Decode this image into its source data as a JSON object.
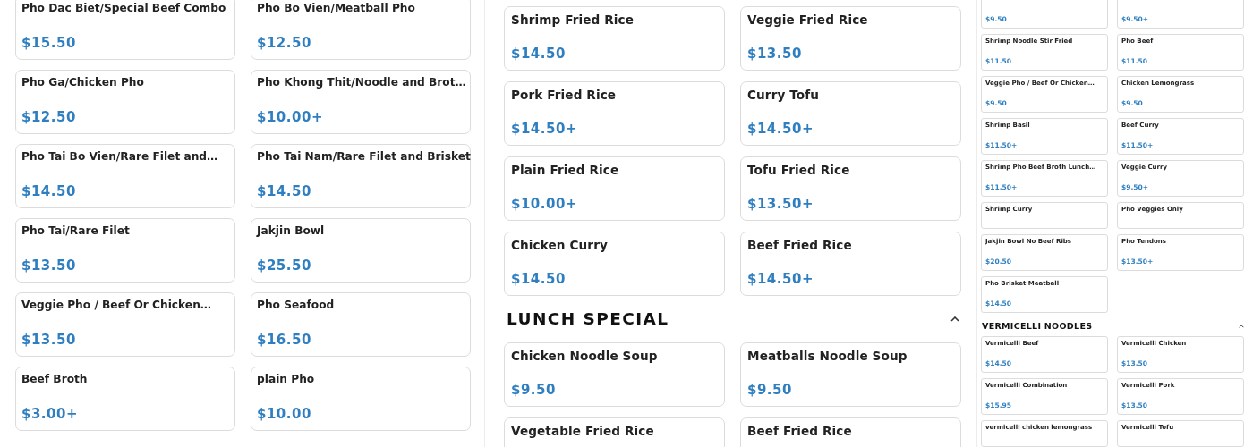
{
  "panes": [
    {
      "kind": "large",
      "sections": [
        {
          "items": [
            {
              "name": "Pho Dac Biet/Special Beef Combo",
              "price": "$15.50"
            },
            {
              "name": "Pho Bo Vien/Meatball Pho",
              "price": "$12.50"
            },
            {
              "name": "Pho Ga/Chicken Pho",
              "price": "$12.50"
            },
            {
              "name": "Pho Khong Thit/Noodle and Brot…",
              "price": "$10.00+"
            },
            {
              "name": "Pho Tai Bo Vien/Rare Filet and…",
              "price": "$14.50"
            },
            {
              "name": "Pho Tai Nam/Rare Filet and Brisket",
              "price": "$14.50"
            },
            {
              "name": "Pho Tai/Rare Filet",
              "price": "$13.50"
            },
            {
              "name": "Jakjin Bowl",
              "price": "$25.50"
            },
            {
              "name": "Veggie Pho / Beef Or Chicken…",
              "price": "$13.50"
            },
            {
              "name": "Pho Seafood",
              "price": "$16.50"
            },
            {
              "name": "Beef Broth",
              "price": "$3.00+"
            },
            {
              "name": "plain Pho",
              "price": "$10.00"
            }
          ]
        }
      ]
    },
    {
      "kind": "medium",
      "sections": [
        {
          "items": [
            {
              "name": "Shrimp Fried Rice",
              "price": "$14.50"
            },
            {
              "name": "Veggie Fried Rice",
              "price": "$13.50"
            },
            {
              "name": "Pork Fried Rice",
              "price": "$14.50+"
            },
            {
              "name": "Curry Tofu",
              "price": "$14.50+"
            },
            {
              "name": "Plain Fried Rice",
              "price": "$10.00+"
            },
            {
              "name": "Tofu Fried Rice",
              "price": "$13.50+"
            },
            {
              "name": "Chicken Curry",
              "price": "$14.50"
            },
            {
              "name": "Beef Fried Rice",
              "price": "$14.50+"
            }
          ]
        },
        {
          "title": "LUNCH SPECIAL",
          "expanded": true,
          "items": [
            {
              "name": "Chicken Noodle Soup",
              "price": "$9.50"
            },
            {
              "name": "Meatballs Noodle Soup",
              "price": "$9.50"
            },
            {
              "name": "Vegetable Fried Rice"
            },
            {
              "name": "Beef Fried Rice"
            }
          ]
        }
      ]
    },
    {
      "kind": "small",
      "sections": [
        {
          "items": [
            {
              "price": "$9.50"
            },
            {
              "price": "$9.50+"
            },
            {
              "name": "Shrimp Noodle Stir Fried",
              "price": "$11.50"
            },
            {
              "name": "Pho Beef",
              "price": "$11.50"
            },
            {
              "name": "Veggie Pho / Beef Or Chicken…",
              "price": "$9.50"
            },
            {
              "name": "Chicken Lemongrass",
              "price": "$9.50"
            },
            {
              "name": "Shrimp Basil",
              "price": "$11.50+"
            },
            {
              "name": "Beef Curry",
              "price": "$11.50+"
            },
            {
              "name": "Shrimp Pho Beef Broth Lunch…",
              "price": "$11.50+"
            },
            {
              "name": "Veggie Curry",
              "price": "$9.50+"
            },
            {
              "name": "Shrimp Curry"
            },
            {
              "name": "Pho Veggies Only"
            },
            {
              "name": "Jakjin Bowl No Beef Ribs",
              "price": "$20.50"
            },
            {
              "name": "Pho Tendons",
              "price": "$13.50+"
            },
            {
              "name": "Pho Brisket Meatball",
              "price": "$14.50"
            }
          ]
        },
        {
          "title": "VERMICELLI NOODLES",
          "expanded": true,
          "items": [
            {
              "name": "Vermicelli Beef",
              "price": "$14.50"
            },
            {
              "name": "Vermicelli Chicken",
              "price": "$13.50"
            },
            {
              "name": "Vermicelli Combination",
              "price": "$15.95"
            },
            {
              "name": "Vermicelli Pork",
              "price": "$13.50"
            },
            {
              "name": "vermicelli chicken lemongrass"
            },
            {
              "name": "Vermicelli Tofu"
            }
          ]
        }
      ]
    }
  ]
}
